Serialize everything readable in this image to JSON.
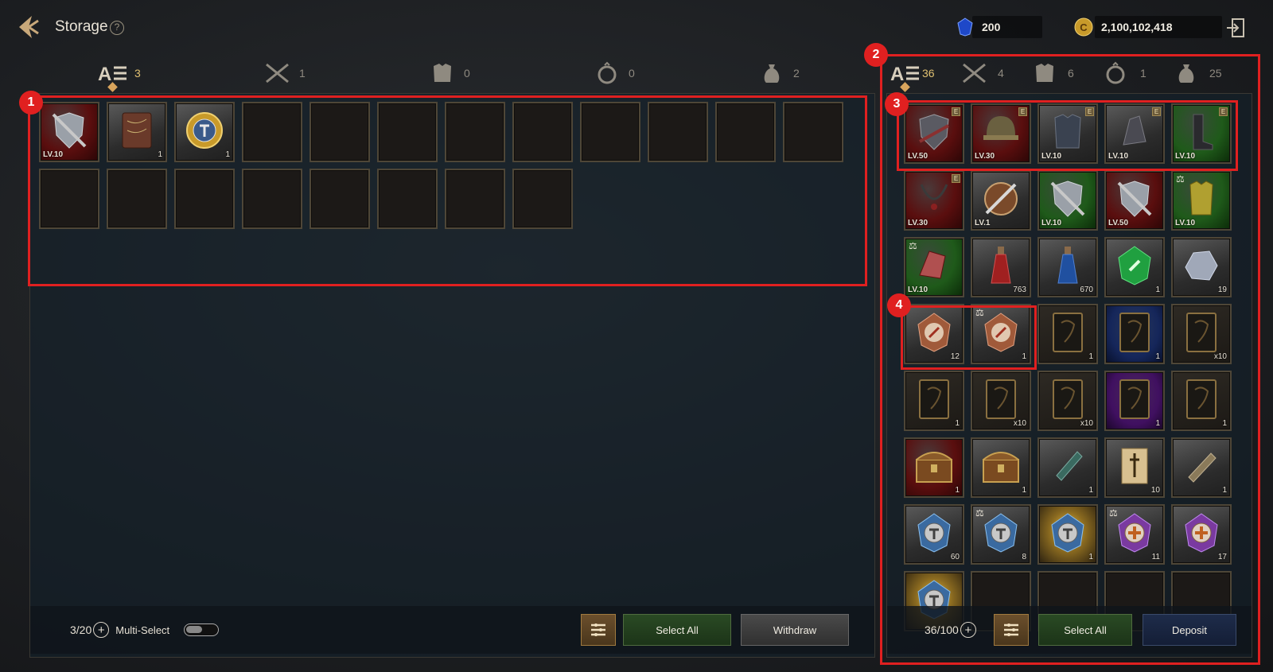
{
  "header": {
    "title": "Storage",
    "help": "?",
    "gems": "200",
    "gold": "2,100,102,418"
  },
  "left_tabs": [
    {
      "name": "all",
      "count": "3"
    },
    {
      "name": "weapons",
      "count": "1"
    },
    {
      "name": "armor",
      "count": "0"
    },
    {
      "name": "accessories",
      "count": "0"
    },
    {
      "name": "materials",
      "count": "2"
    }
  ],
  "right_tabs": [
    {
      "name": "all",
      "count": "36"
    },
    {
      "name": "weapons",
      "count": "4"
    },
    {
      "name": "armor",
      "count": "6"
    },
    {
      "name": "accessories",
      "count": "1"
    },
    {
      "name": "materials",
      "count": "25"
    }
  ],
  "storage_items": [
    {
      "name": "sword-and-shield",
      "rarity": "red",
      "level": "LV.10",
      "qty": ""
    },
    {
      "name": "book",
      "rarity": "gray",
      "level": "",
      "qty": "1"
    },
    {
      "name": "gold-medallion",
      "rarity": "gray",
      "level": "",
      "qty": "1"
    }
  ],
  "inventory_items": [
    {
      "name": "dark-shield-armor",
      "rarity": "red",
      "level": "LV.50",
      "qty": "",
      "equipped": "E"
    },
    {
      "name": "helmet",
      "rarity": "red",
      "level": "LV.30",
      "qty": "",
      "equipped": "E"
    },
    {
      "name": "chest-armor",
      "rarity": "gray",
      "level": "LV.10",
      "qty": "",
      "equipped": "E"
    },
    {
      "name": "gauntlets",
      "rarity": "gray",
      "level": "LV.10",
      "qty": "",
      "equipped": "E"
    },
    {
      "name": "boots",
      "rarity": "green",
      "level": "LV.10",
      "qty": "",
      "equipped": "E"
    },
    {
      "name": "necklace",
      "rarity": "red",
      "level": "LV.30",
      "qty": "",
      "equipped": "E"
    },
    {
      "name": "round-shield-sword",
      "rarity": "gray",
      "level": "LV.1",
      "qty": ""
    },
    {
      "name": "sword-and-shield",
      "rarity": "green",
      "level": "LV.10",
      "qty": ""
    },
    {
      "name": "sword-and-shield",
      "rarity": "red",
      "level": "LV.50",
      "qty": ""
    },
    {
      "name": "yellow-tunic",
      "rarity": "green",
      "level": "LV.10",
      "qty": "",
      "trade": "⚖"
    },
    {
      "name": "glove",
      "rarity": "green",
      "level": "LV.10",
      "qty": "",
      "trade": "⚖"
    },
    {
      "name": "red-potion",
      "rarity": "gray",
      "level": "",
      "qty": "763"
    },
    {
      "name": "blue-potion",
      "rarity": "gray",
      "level": "",
      "qty": "670"
    },
    {
      "name": "green-gem",
      "rarity": "gray",
      "level": "",
      "qty": "1"
    },
    {
      "name": "ore",
      "rarity": "gray",
      "level": "",
      "qty": "19"
    },
    {
      "name": "compass-stone",
      "rarity": "gray",
      "level": "",
      "qty": "12"
    },
    {
      "name": "compass-stone",
      "rarity": "gray",
      "level": "",
      "qty": "1",
      "trade": "⚖"
    },
    {
      "name": "card",
      "rarity": "dark",
      "level": "",
      "qty": "1"
    },
    {
      "name": "card",
      "rarity": "blue",
      "level": "",
      "qty": "1"
    },
    {
      "name": "card",
      "rarity": "dark",
      "level": "",
      "qty": "x10"
    },
    {
      "name": "card",
      "rarity": "dark",
      "level": "",
      "qty": "1"
    },
    {
      "name": "card",
      "rarity": "dark",
      "level": "",
      "qty": "x10"
    },
    {
      "name": "card",
      "rarity": "dark",
      "level": "",
      "qty": "x10"
    },
    {
      "name": "card",
      "rarity": "purple",
      "level": "",
      "qty": "1"
    },
    {
      "name": "card",
      "rarity": "dark",
      "level": "",
      "qty": "1"
    },
    {
      "name": "treasure-chest",
      "rarity": "red",
      "level": "",
      "qty": "1"
    },
    {
      "name": "treasure-chest",
      "rarity": "gray",
      "level": "",
      "qty": "1"
    },
    {
      "name": "scroll-teal",
      "rarity": "gray",
      "level": "",
      "qty": "1"
    },
    {
      "name": "scroll-sword",
      "rarity": "gray",
      "level": "",
      "qty": "10"
    },
    {
      "name": "scroll-rolled",
      "rarity": "gray",
      "level": "",
      "qty": "1"
    },
    {
      "name": "crystal-medallion",
      "rarity": "gray",
      "level": "",
      "qty": "60"
    },
    {
      "name": "crystal-medallion",
      "rarity": "gray",
      "level": "",
      "qty": "8",
      "trade": "⚖"
    },
    {
      "name": "crystal-medallion",
      "rarity": "gold",
      "level": "",
      "qty": "1"
    },
    {
      "name": "purple-cross-medallion",
      "rarity": "gray",
      "level": "",
      "qty": "11",
      "trade": "⚖"
    },
    {
      "name": "purple-cross-medallion",
      "rarity": "gray",
      "level": "",
      "qty": "17"
    },
    {
      "name": "crystal-medallion",
      "rarity": "gold",
      "level": "",
      "qty": ""
    }
  ],
  "left_footer": {
    "capacity": "3/20",
    "multi_select": "Multi-Select",
    "select_all": "Select All",
    "withdraw": "Withdraw"
  },
  "right_footer": {
    "capacity": "36/100",
    "select_all": "Select All",
    "deposit": "Deposit"
  },
  "callouts": [
    "1",
    "2",
    "3",
    "4"
  ],
  "colors": {
    "callout": "#e02020",
    "active_tab_count": "#e0c071",
    "select_all_button": "#2a4a24",
    "deposit_button": "#1e2c4a",
    "withdraw_button": "#4a4a4a"
  }
}
